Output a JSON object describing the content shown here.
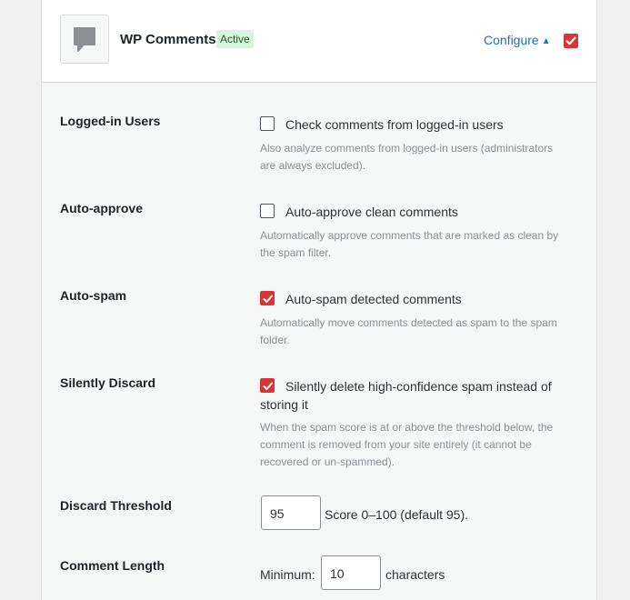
{
  "module": {
    "title": "WP Comments",
    "badge": "Active",
    "configure_label": "Configure",
    "configure_caret": "▲",
    "enabled": true,
    "icon": "speech-bubble-icon"
  },
  "settings": {
    "logged_in": {
      "label": "Logged-in Users",
      "checkbox_label": "Check comments from logged-in users",
      "checked": false,
      "description": "Also analyze comments from logged-in users (administrators are always excluded)."
    },
    "auto_approve": {
      "label": "Auto-approve",
      "checkbox_label": "Auto-approve clean comments",
      "checked": false,
      "description": "Automatically approve comments that are marked as clean by the spam filter."
    },
    "auto_spam": {
      "label": "Auto-spam",
      "checkbox_label": "Auto-spam detected comments",
      "checked": true,
      "description": "Automatically move comments detected as spam to the spam folder."
    },
    "silently_discard": {
      "label": "Silently Discard",
      "checkbox_label": "Silently delete high-confidence spam instead of storing it",
      "checked": true,
      "description": "When the spam score is at or above the threshold below, the comment is removed from your site entirely (it cannot be recovered or un-spammed)."
    },
    "discard_threshold": {
      "label": "Discard Threshold",
      "value": "95",
      "hint": "Score 0–100 (default 95)."
    },
    "comment_length": {
      "label": "Comment Length",
      "prefix": "Minimum:",
      "value": "10",
      "suffix": "characters"
    }
  },
  "colors": {
    "accent": "#d63638",
    "link": "#2271b1",
    "badge_bg": "#d7f5dc"
  }
}
